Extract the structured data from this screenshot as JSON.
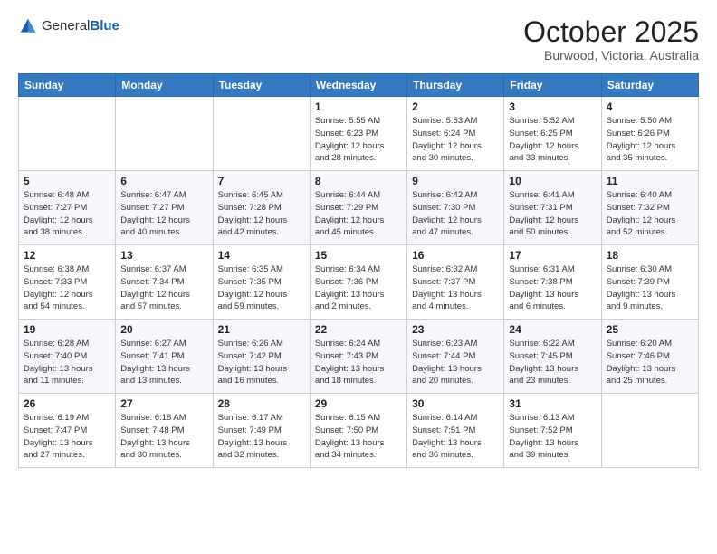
{
  "header": {
    "logo_general": "General",
    "logo_blue": "Blue",
    "title": "October 2025",
    "subtitle": "Burwood, Victoria, Australia"
  },
  "days_of_week": [
    "Sunday",
    "Monday",
    "Tuesday",
    "Wednesday",
    "Thursday",
    "Friday",
    "Saturday"
  ],
  "weeks": [
    [
      {
        "num": "",
        "info": ""
      },
      {
        "num": "",
        "info": ""
      },
      {
        "num": "",
        "info": ""
      },
      {
        "num": "1",
        "info": "Sunrise: 5:55 AM\nSunset: 6:23 PM\nDaylight: 12 hours\nand 28 minutes."
      },
      {
        "num": "2",
        "info": "Sunrise: 5:53 AM\nSunset: 6:24 PM\nDaylight: 12 hours\nand 30 minutes."
      },
      {
        "num": "3",
        "info": "Sunrise: 5:52 AM\nSunset: 6:25 PM\nDaylight: 12 hours\nand 33 minutes."
      },
      {
        "num": "4",
        "info": "Sunrise: 5:50 AM\nSunset: 6:26 PM\nDaylight: 12 hours\nand 35 minutes."
      }
    ],
    [
      {
        "num": "5",
        "info": "Sunrise: 6:48 AM\nSunset: 7:27 PM\nDaylight: 12 hours\nand 38 minutes."
      },
      {
        "num": "6",
        "info": "Sunrise: 6:47 AM\nSunset: 7:27 PM\nDaylight: 12 hours\nand 40 minutes."
      },
      {
        "num": "7",
        "info": "Sunrise: 6:45 AM\nSunset: 7:28 PM\nDaylight: 12 hours\nand 42 minutes."
      },
      {
        "num": "8",
        "info": "Sunrise: 6:44 AM\nSunset: 7:29 PM\nDaylight: 12 hours\nand 45 minutes."
      },
      {
        "num": "9",
        "info": "Sunrise: 6:42 AM\nSunset: 7:30 PM\nDaylight: 12 hours\nand 47 minutes."
      },
      {
        "num": "10",
        "info": "Sunrise: 6:41 AM\nSunset: 7:31 PM\nDaylight: 12 hours\nand 50 minutes."
      },
      {
        "num": "11",
        "info": "Sunrise: 6:40 AM\nSunset: 7:32 PM\nDaylight: 12 hours\nand 52 minutes."
      }
    ],
    [
      {
        "num": "12",
        "info": "Sunrise: 6:38 AM\nSunset: 7:33 PM\nDaylight: 12 hours\nand 54 minutes."
      },
      {
        "num": "13",
        "info": "Sunrise: 6:37 AM\nSunset: 7:34 PM\nDaylight: 12 hours\nand 57 minutes."
      },
      {
        "num": "14",
        "info": "Sunrise: 6:35 AM\nSunset: 7:35 PM\nDaylight: 12 hours\nand 59 minutes."
      },
      {
        "num": "15",
        "info": "Sunrise: 6:34 AM\nSunset: 7:36 PM\nDaylight: 13 hours\nand 2 minutes."
      },
      {
        "num": "16",
        "info": "Sunrise: 6:32 AM\nSunset: 7:37 PM\nDaylight: 13 hours\nand 4 minutes."
      },
      {
        "num": "17",
        "info": "Sunrise: 6:31 AM\nSunset: 7:38 PM\nDaylight: 13 hours\nand 6 minutes."
      },
      {
        "num": "18",
        "info": "Sunrise: 6:30 AM\nSunset: 7:39 PM\nDaylight: 13 hours\nand 9 minutes."
      }
    ],
    [
      {
        "num": "19",
        "info": "Sunrise: 6:28 AM\nSunset: 7:40 PM\nDaylight: 13 hours\nand 11 minutes."
      },
      {
        "num": "20",
        "info": "Sunrise: 6:27 AM\nSunset: 7:41 PM\nDaylight: 13 hours\nand 13 minutes."
      },
      {
        "num": "21",
        "info": "Sunrise: 6:26 AM\nSunset: 7:42 PM\nDaylight: 13 hours\nand 16 minutes."
      },
      {
        "num": "22",
        "info": "Sunrise: 6:24 AM\nSunset: 7:43 PM\nDaylight: 13 hours\nand 18 minutes."
      },
      {
        "num": "23",
        "info": "Sunrise: 6:23 AM\nSunset: 7:44 PM\nDaylight: 13 hours\nand 20 minutes."
      },
      {
        "num": "24",
        "info": "Sunrise: 6:22 AM\nSunset: 7:45 PM\nDaylight: 13 hours\nand 23 minutes."
      },
      {
        "num": "25",
        "info": "Sunrise: 6:20 AM\nSunset: 7:46 PM\nDaylight: 13 hours\nand 25 minutes."
      }
    ],
    [
      {
        "num": "26",
        "info": "Sunrise: 6:19 AM\nSunset: 7:47 PM\nDaylight: 13 hours\nand 27 minutes."
      },
      {
        "num": "27",
        "info": "Sunrise: 6:18 AM\nSunset: 7:48 PM\nDaylight: 13 hours\nand 30 minutes."
      },
      {
        "num": "28",
        "info": "Sunrise: 6:17 AM\nSunset: 7:49 PM\nDaylight: 13 hours\nand 32 minutes."
      },
      {
        "num": "29",
        "info": "Sunrise: 6:15 AM\nSunset: 7:50 PM\nDaylight: 13 hours\nand 34 minutes."
      },
      {
        "num": "30",
        "info": "Sunrise: 6:14 AM\nSunset: 7:51 PM\nDaylight: 13 hours\nand 36 minutes."
      },
      {
        "num": "31",
        "info": "Sunrise: 6:13 AM\nSunset: 7:52 PM\nDaylight: 13 hours\nand 39 minutes."
      },
      {
        "num": "",
        "info": ""
      }
    ]
  ]
}
